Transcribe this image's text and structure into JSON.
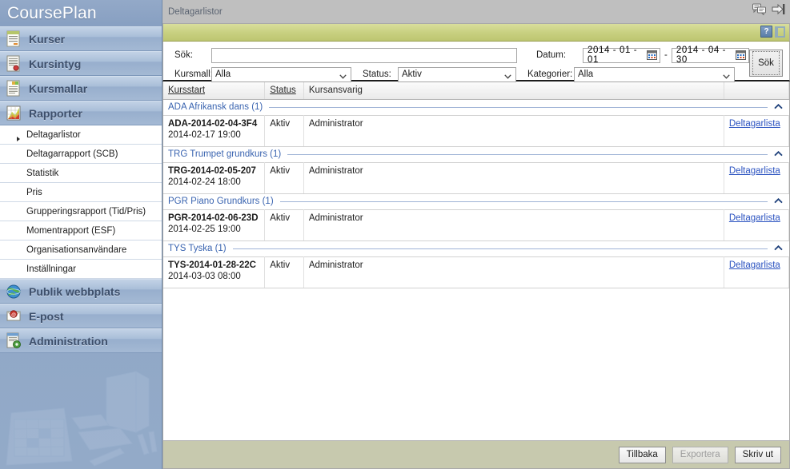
{
  "brand": {
    "title": "CoursePlan"
  },
  "sidebar": {
    "main_items": [
      {
        "label": "Kurser",
        "icon": "document-lines-icon"
      },
      {
        "label": "Kursintyg",
        "icon": "certificate-icon"
      },
      {
        "label": "Kursmallar",
        "icon": "template-icon"
      },
      {
        "label": "Rapporter",
        "icon": "chart-icon"
      }
    ],
    "sub_items": [
      {
        "label": "Deltagarlistor",
        "active": true
      },
      {
        "label": "Deltagarrapport (SCB)",
        "active": false
      },
      {
        "label": "Statistik",
        "active": false
      },
      {
        "label": "Pris",
        "active": false
      },
      {
        "label": "Grupperingsrapport (Tid/Pris)",
        "active": false
      },
      {
        "label": "Momentrapport (ESF)",
        "active": false
      },
      {
        "label": "Organisationsanvändare",
        "active": false
      },
      {
        "label": "Inställningar",
        "active": false
      }
    ],
    "bottom_items": [
      {
        "label": "Publik webbplats",
        "icon": "globe-icon"
      },
      {
        "label": "E-post",
        "icon": "mail-icon"
      },
      {
        "label": "Administration",
        "icon": "admin-gear-icon"
      }
    ]
  },
  "topbar": {
    "page_tab": "Deltagarlistor",
    "icons": [
      "chat-bubbles-icon",
      "logout-arrow-icon"
    ]
  },
  "olivebar": {
    "help_label": "?",
    "help_extra_icon": "panel-icon"
  },
  "search": {
    "sok_label": "Sök:",
    "sok_value": "",
    "sok_placeholder": "",
    "kursmall_label": "Kursmall:",
    "kursmall_value": "Alla",
    "status_label": "Status:",
    "status_value": "Aktiv",
    "datum_label": "Datum:",
    "date_from": "2014 - 01 - 01",
    "date_to": "2014 - 04 - 30",
    "date_separator": "-",
    "kategorier_label": "Kategorier:",
    "kategorier_value": "Alla",
    "submit_label": "Sök"
  },
  "table": {
    "headers": [
      {
        "label": "Kursstart",
        "sortable": true
      },
      {
        "label": "Status",
        "sortable": true
      },
      {
        "label": "Kursansvarig",
        "sortable": false
      },
      {
        "label": "",
        "sortable": false
      }
    ],
    "groups": [
      {
        "name": "ADA Afrikansk dans (1)",
        "collapse_icon": "chevron-up-icon",
        "rows": [
          {
            "code": "ADA-2014-02-04-3F4",
            "date": "2014-02-17 19:00",
            "status": "Aktiv",
            "responsible": "Administrator",
            "link": "Deltagarlista"
          }
        ]
      },
      {
        "name": "TRG Trumpet grundkurs (1)",
        "collapse_icon": "chevron-up-icon",
        "rows": [
          {
            "code": "TRG-2014-02-05-207",
            "date": "2014-02-24 18:00",
            "status": "Aktiv",
            "responsible": "Administrator",
            "link": "Deltagarlista"
          }
        ]
      },
      {
        "name": "PGR Piano Grundkurs (1)",
        "collapse_icon": "chevron-up-icon",
        "rows": [
          {
            "code": "PGR-2014-02-06-23D",
            "date": "2014-02-25 19:00",
            "status": "Aktiv",
            "responsible": "Administrator",
            "link": "Deltagarlista"
          }
        ]
      },
      {
        "name": "TYS Tyska (1)",
        "collapse_icon": "chevron-up-icon",
        "rows": [
          {
            "code": "TYS-2014-01-28-22C",
            "date": "2014-03-03 08:00",
            "status": "Aktiv",
            "responsible": "Administrator",
            "link": "Deltagarlista"
          }
        ]
      }
    ]
  },
  "footer": {
    "back_label": "Tillbaka",
    "export_label": "Exportera",
    "print_label": "Skriv ut"
  },
  "colors": {
    "sidebar_blue": "#8ba4c4",
    "olive": "#c7cf7f",
    "footer_bg": "#c7c9ae",
    "link_blue": "#2a52c0",
    "group_blue": "#3a64b0",
    "topbar_gray": "#bfbfbf"
  }
}
